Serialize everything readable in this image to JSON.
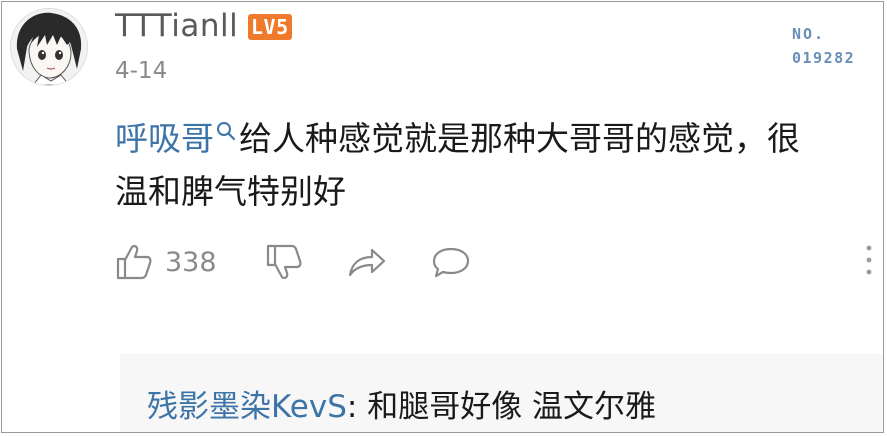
{
  "comment": {
    "username": "TTTianll",
    "level_badge": "LV5",
    "date": "4-14",
    "floor_label": "NO.",
    "floor_number": "019282",
    "mention": "呼吸哥",
    "text_line1": "给人种感觉就是那种大哥哥的感觉，很",
    "text_line2": "温和脾气特别好",
    "likes": "338"
  },
  "reply": {
    "author": "残影墨染KevS",
    "separator": ": ",
    "text": "和腿哥好像 温文尔雅"
  },
  "icons": {
    "like": "thumbs-up-icon",
    "dislike": "thumbs-down-icon",
    "share": "share-icon",
    "reply": "comment-icon",
    "more": "more-vertical-icon",
    "mention": "search-icon"
  },
  "colors": {
    "link": "#3d74a8",
    "level_badge": "#f07a2c",
    "floor_number": "#6a8eb8",
    "muted": "#8a8a8a"
  }
}
